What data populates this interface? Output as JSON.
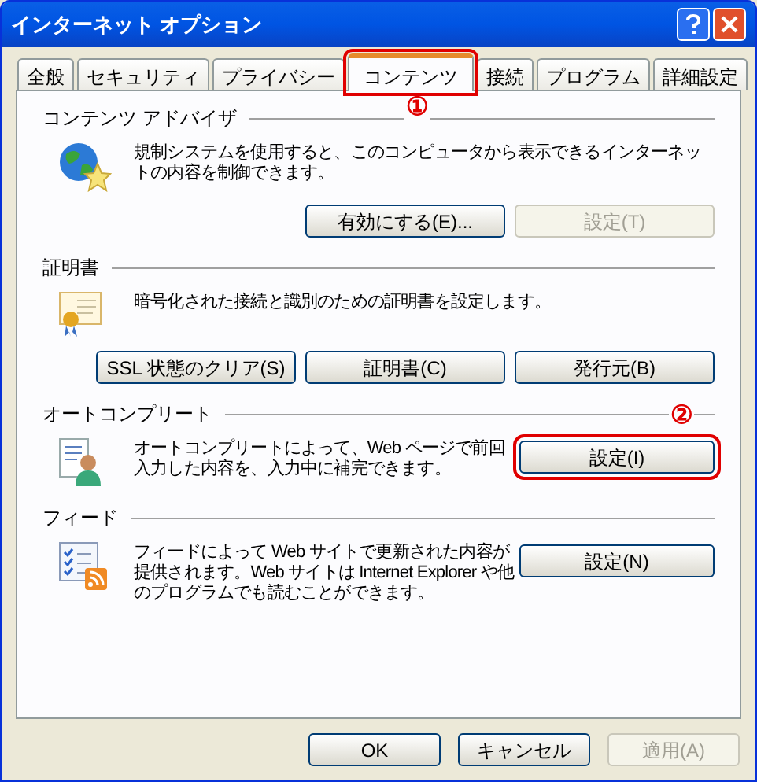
{
  "window": {
    "title": "インターネット オプション"
  },
  "tabs": [
    {
      "label": "全般",
      "selected": false,
      "outlined": false
    },
    {
      "label": "セキュリティ",
      "selected": false,
      "outlined": false
    },
    {
      "label": "プライバシー",
      "selected": false,
      "outlined": false
    },
    {
      "label": "コンテンツ",
      "selected": true,
      "outlined": true
    },
    {
      "label": "接続",
      "selected": false,
      "outlined": false
    },
    {
      "label": "プログラム",
      "selected": false,
      "outlined": false
    },
    {
      "label": "詳細設定",
      "selected": false,
      "outlined": false
    }
  ],
  "sections": [
    {
      "title": "コンテンツ アドバイザ",
      "kind": "stacked",
      "description": "規制システムを使用すると、このコンピュータから表示できるインターネットの内容を制御できます。",
      "buttons": [
        {
          "label": "有効にする(E)...",
          "disabled": false,
          "outlined": false
        },
        {
          "label": "設定(T)",
          "disabled": true,
          "outlined": false
        }
      ]
    },
    {
      "title": "証明書",
      "kind": "stacked",
      "description": "暗号化された接続と識別のための証明書を設定します。",
      "buttons": [
        {
          "label": "SSL 状態のクリア(S)",
          "disabled": false,
          "outlined": false
        },
        {
          "label": "証明書(C)",
          "disabled": false,
          "outlined": false
        },
        {
          "label": "発行元(B)",
          "disabled": false,
          "outlined": false
        }
      ]
    },
    {
      "title": "オートコンプリート",
      "kind": "side",
      "description": "オートコンプリートによって、Web ページで前回入力した内容を、入力中に補完できます。",
      "buttons": [
        {
          "label": "設定(I)",
          "disabled": false,
          "outlined": true
        }
      ]
    },
    {
      "title": "フィード",
      "kind": "side",
      "description": "フィードによって Web サイトで更新された内容が提供されます。Web サイトは Internet Explorer や他のプログラムでも読むことができます。",
      "buttons": [
        {
          "label": "設定(N)",
          "disabled": false,
          "outlined": false
        }
      ]
    }
  ],
  "annotations": [
    {
      "label": "①"
    },
    {
      "label": "②"
    }
  ],
  "buttons": [
    {
      "label": "OK",
      "disabled": false
    },
    {
      "label": "キャンセル",
      "disabled": false
    },
    {
      "label": "適用(A)",
      "disabled": true
    }
  ]
}
